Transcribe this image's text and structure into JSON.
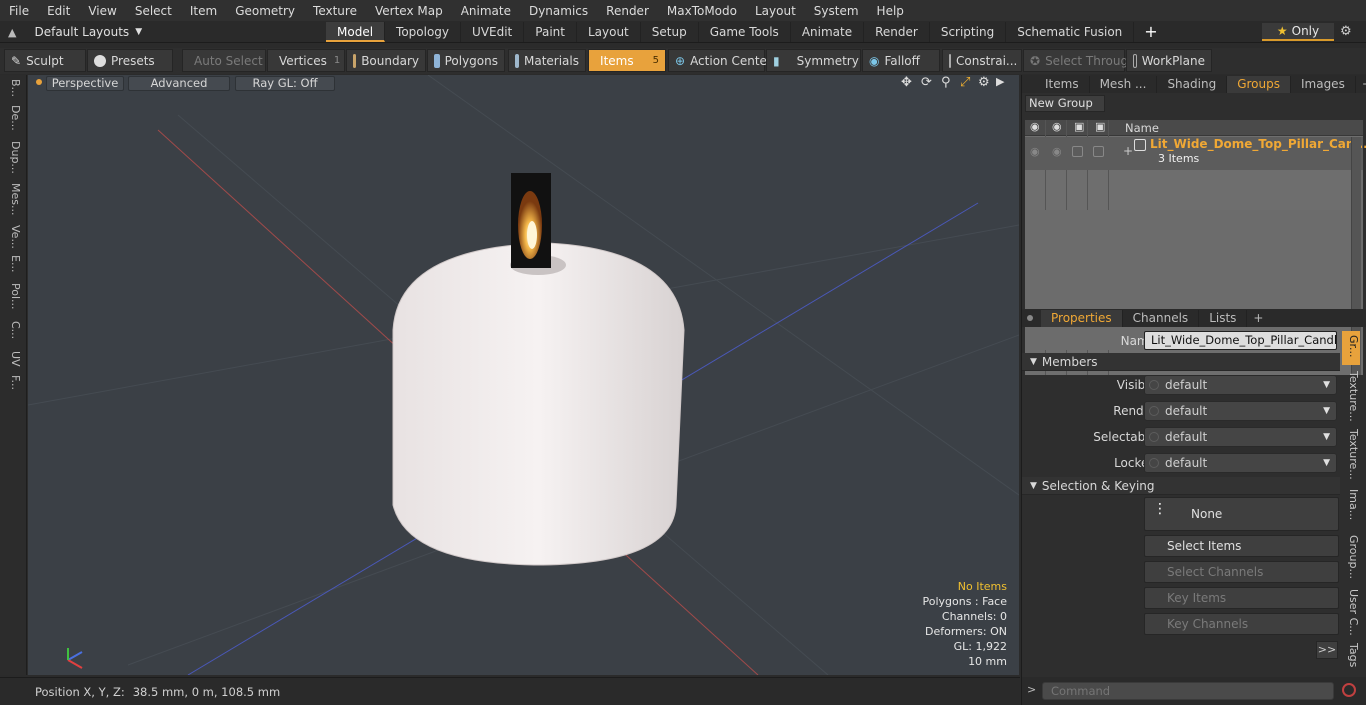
{
  "menu": [
    "File",
    "Edit",
    "View",
    "Select",
    "Item",
    "Geometry",
    "Texture",
    "Vertex Map",
    "Animate",
    "Dynamics",
    "Render",
    "MaxToModo",
    "Layout",
    "System",
    "Help"
  ],
  "layout_dropdown": "Default Layouts",
  "mode_tabs": [
    "Model",
    "Topology",
    "UVEdit",
    "Paint",
    "Layout",
    "Setup",
    "Game Tools",
    "Animate",
    "Render",
    "Scripting",
    "Schematic Fusion"
  ],
  "active_mode_tab": "Model",
  "only_label": "Only",
  "toolbar": {
    "sculpt": "Sculpt",
    "presets": "Presets",
    "auto_select": "Auto Select",
    "vertices": "Vertices",
    "vertices_count": "1",
    "boundary": "Boundary",
    "polygons": "Polygons",
    "materials": "Materials",
    "items": "Items",
    "items_count": "5",
    "action_center": "Action Center",
    "symmetry": "Symmetry",
    "falloff": "Falloff",
    "constraints": "Constrai...",
    "select_through": "Select Through",
    "workplane": "WorkPlane"
  },
  "left_tabs": [
    "B...",
    "De...",
    "Dup...",
    "Mes...",
    "Ve...",
    "E...",
    "Pol...",
    "C...",
    "UV",
    "F..."
  ],
  "viewport": {
    "view_mode": "Perspective",
    "shading": "Advanced",
    "raygl": "Ray GL: Off",
    "info": {
      "items": "No Items",
      "polygons": "Polygons : Face",
      "channels": "Channels: 0",
      "deformers": "Deformers: ON",
      "gl": "GL: 1,922",
      "scale": "10 mm"
    }
  },
  "status": {
    "label": "Position X, Y, Z:",
    "value": "38.5 mm, 0 m, 108.5 mm"
  },
  "panel_tabs": [
    "Items",
    "Mesh ...",
    "Shading",
    "Groups",
    "Images"
  ],
  "active_panel_tab": "Groups",
  "groups": {
    "new_group": "New Group",
    "name_header": "Name",
    "group_name": "Lit_Wide_Dome_Top_Pillar_Can ...",
    "group_count": "3 Items"
  },
  "prop_tabs": [
    "Properties",
    "Channels",
    "Lists"
  ],
  "active_prop_tab": "Properties",
  "properties": {
    "name_label": "Name",
    "name_value": "Lit_Wide_Dome_Top_Pillar_Candle_Wi",
    "members_header": "Members",
    "visible_label": "Visible",
    "visible_value": "default",
    "render_label": "Render",
    "render_value": "default",
    "selectable_label": "Selectable",
    "selectable_value": "default",
    "locked_label": "Locked",
    "locked_value": "default",
    "selkey_header": "Selection & Keying",
    "none_button": "None",
    "select_items": "Select Items",
    "select_channels": "Select Channels",
    "key_items": "Key Items",
    "key_channels": "Key Channels",
    "more": ">>"
  },
  "right_vtabs": [
    "Gr...",
    "Texture...",
    "Texture...",
    "Ima...",
    "Group...",
    "User C...",
    "Tags"
  ],
  "command_placeholder": "Command",
  "colors": {
    "accent": "#e8a23c",
    "viewport_bg": "#3b4046",
    "group_name": "#f0a835"
  }
}
